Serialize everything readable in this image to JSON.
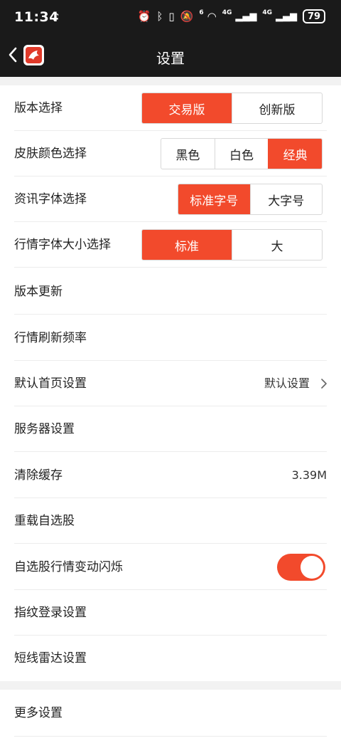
{
  "status_bar": {
    "time": "11:34",
    "battery": "79",
    "network_1": "4G",
    "network_2": "4G",
    "wifi_badge": "6"
  },
  "nav": {
    "title": "设置"
  },
  "settings": {
    "version_select": {
      "label": "版本选择",
      "options": [
        "交易版",
        "创新版"
      ],
      "selected": "交易版"
    },
    "skin_color": {
      "label": "皮肤颜色选择",
      "options": [
        "黑色",
        "白色",
        "经典"
      ],
      "selected": "经典"
    },
    "news_font": {
      "label": "资讯字体选择",
      "options": [
        "标准字号",
        "大字号"
      ],
      "selected": "标准字号"
    },
    "quote_font_size": {
      "label": "行情字体大小选择",
      "options": [
        "标准",
        "大"
      ],
      "selected": "标准"
    },
    "version_update": {
      "label": "版本更新"
    },
    "refresh_rate": {
      "label": "行情刷新频率"
    },
    "default_home": {
      "label": "默认首页设置",
      "value": "默认设置"
    },
    "server": {
      "label": "服务器设置"
    },
    "clear_cache": {
      "label": "清除缓存",
      "value": "3.39M"
    },
    "reload_watchlist": {
      "label": "重载自选股"
    },
    "watchlist_flash": {
      "label": "自选股行情变动闪烁",
      "enabled": true
    },
    "fingerprint": {
      "label": "指纹登录设置"
    },
    "short_radar": {
      "label": "短线雷达设置"
    },
    "more": {
      "label": "更多设置"
    }
  },
  "colors": {
    "accent": "#f24a2c",
    "header_bg": "#1a1a1a",
    "section_gap": "#f2f2f2"
  }
}
